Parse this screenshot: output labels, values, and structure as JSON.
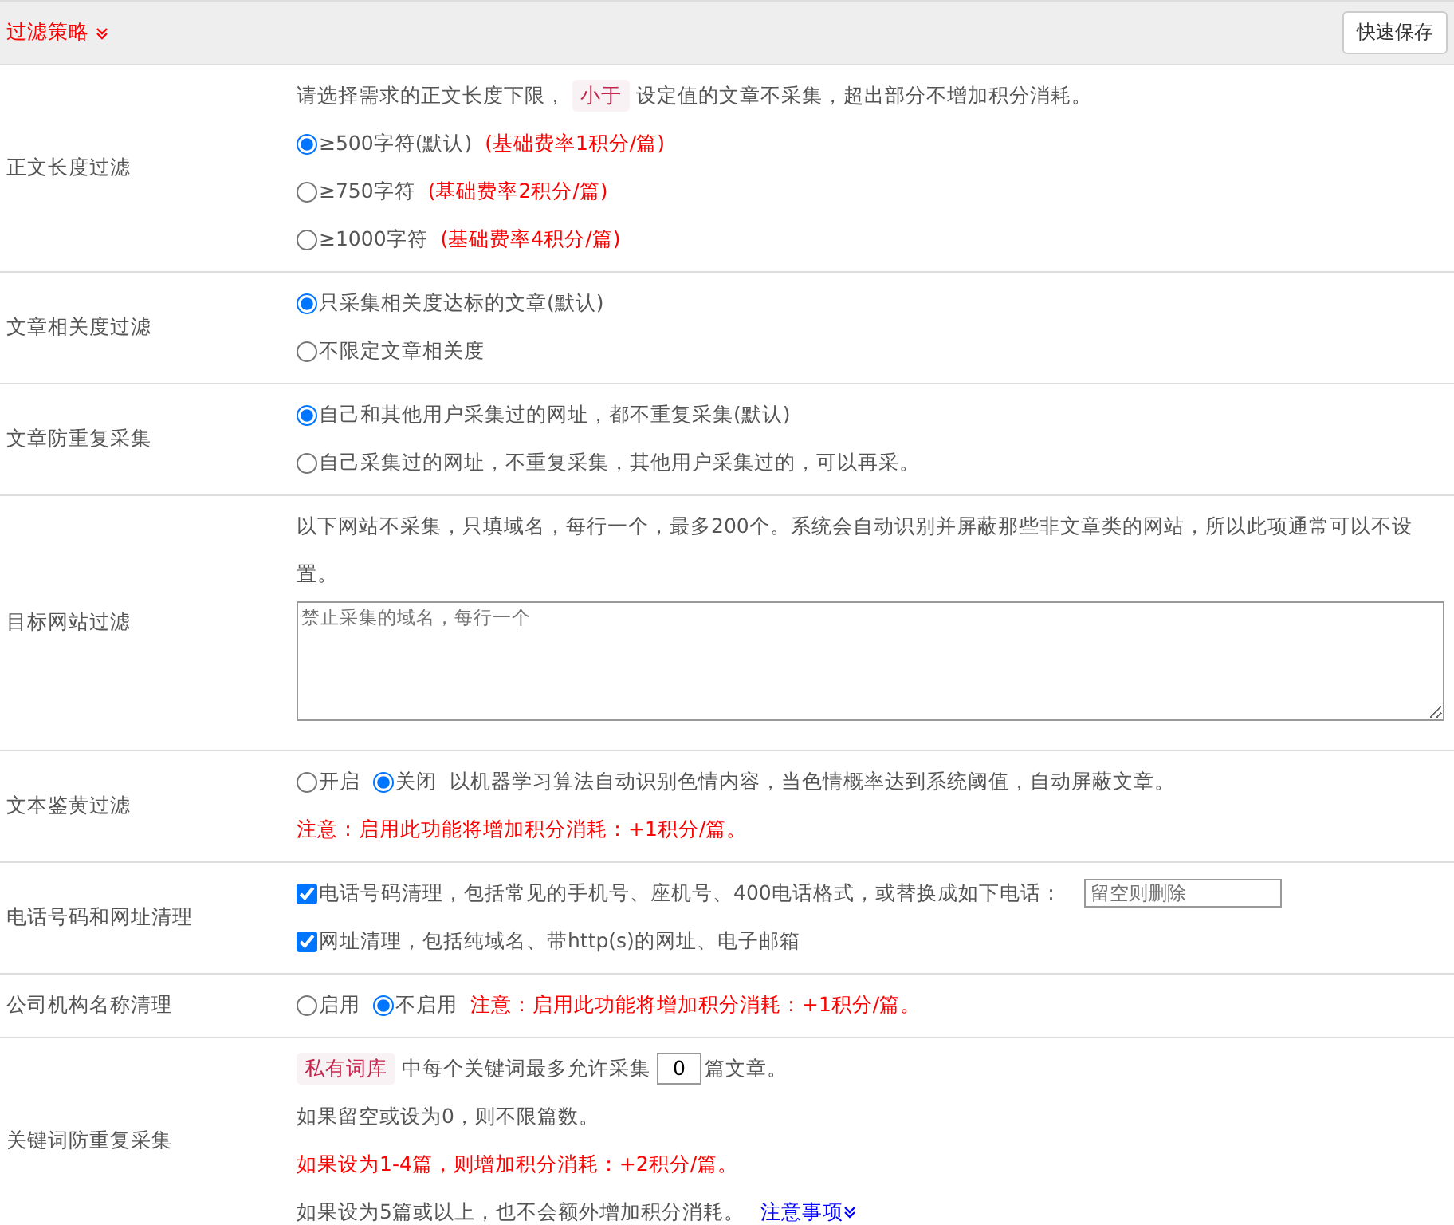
{
  "header": {
    "title": "过滤策略",
    "save_button": "快速保存"
  },
  "sections": [
    {
      "label": "正文长度过滤",
      "lines": [
        [
          {
            "kind": "text",
            "text": "请选择需求的正文长度下限，"
          },
          {
            "kind": "tag",
            "text": "小于"
          },
          {
            "kind": "text",
            "text": "设定值的文章不采集，超出部分不增加积分消耗。"
          }
        ],
        [
          {
            "kind": "radio",
            "text": "≥500字符(默认)",
            "selected": true
          },
          {
            "kind": "note",
            "text": "(基础费率1积分/篇)"
          }
        ],
        [
          {
            "kind": "radio",
            "text": "≥750字符",
            "selected": false
          },
          {
            "kind": "note",
            "text": "(基础费率2积分/篇)"
          }
        ],
        [
          {
            "kind": "radio",
            "text": "≥1000字符",
            "selected": false
          },
          {
            "kind": "note",
            "text": "(基础费率4积分/篇)"
          }
        ]
      ]
    },
    {
      "label": "文章相关度过滤",
      "lines": [
        [
          {
            "kind": "radio",
            "text": "只采集相关度达标的文章(默认)",
            "selected": true
          }
        ],
        [
          {
            "kind": "radio",
            "text": "不限定文章相关度",
            "selected": false
          }
        ]
      ]
    },
    {
      "label": "文章防重复采集",
      "lines": [
        [
          {
            "kind": "radio",
            "text": "自己和其他用户采集过的网址，都不重复采集(默认)",
            "selected": true
          }
        ],
        [
          {
            "kind": "radio",
            "text": "自己采集过的网址，不重复采集，其他用户采集过的，可以再采。",
            "selected": false
          }
        ]
      ]
    },
    {
      "label": "目标网站过滤",
      "lines": [
        [
          {
            "kind": "text",
            "text": "以下网站不采集，只填域名，每行一个，最多200个。系统会自动识别并屏蔽那些非文章类的网站，所以此项通常可以不设置。"
          }
        ],
        [
          {
            "kind": "textarea",
            "placeholder": "禁止采集的域名，每行一个"
          }
        ]
      ]
    },
    {
      "label": "文本鉴黄过滤",
      "lines": [
        [
          {
            "kind": "radio",
            "text": "开启",
            "selected": false
          },
          {
            "kind": "radio",
            "text": "关闭",
            "selected": true
          },
          {
            "kind": "text",
            "text": "以机器学习算法自动识别色情内容，当色情概率达到系统阈值，自动屏蔽文章。"
          }
        ],
        [
          {
            "kind": "note",
            "text": "注意：启用此功能将增加积分消耗：+1积分/篇。"
          }
        ]
      ]
    },
    {
      "label": "电话号码和网址清理",
      "lines": [
        [
          {
            "kind": "checkbox",
            "text": "电话号码清理，包括常见的手机号、座机号、400电话格式，或替换成如下电话：",
            "checked": true
          },
          {
            "kind": "input",
            "placeholder": "留空则删除"
          }
        ],
        [
          {
            "kind": "checkbox",
            "text": "网址清理，包括纯域名、带http(s)的网址、电子邮箱",
            "checked": true
          }
        ]
      ]
    },
    {
      "label": "公司机构名称清理",
      "lines": [
        [
          {
            "kind": "radio",
            "text": "启用",
            "selected": false
          },
          {
            "kind": "radio",
            "text": "不启用",
            "selected": true
          },
          {
            "kind": "note",
            "text": "注意：启用此功能将增加积分消耗：+1积分/篇。"
          }
        ]
      ]
    },
    {
      "label": "关键词防重复采集",
      "lines": [
        [
          {
            "kind": "tag",
            "text": "私有词库"
          },
          {
            "kind": "text",
            "text": "中每个关键词最多允许采集"
          },
          {
            "kind": "number",
            "value": "0"
          },
          {
            "kind": "text",
            "text": "篇文章。"
          }
        ],
        [
          {
            "kind": "text",
            "text": "如果留空或设为0，则不限篇数。"
          }
        ],
        [
          {
            "kind": "note",
            "text": "如果设为1-4篇，则增加积分消耗：+2积分/篇。"
          }
        ],
        [
          {
            "kind": "text",
            "text": "如果设为5篇或以上，也不会额外增加积分消耗。"
          },
          {
            "kind": "link",
            "text": "注意事项"
          }
        ]
      ]
    }
  ]
}
